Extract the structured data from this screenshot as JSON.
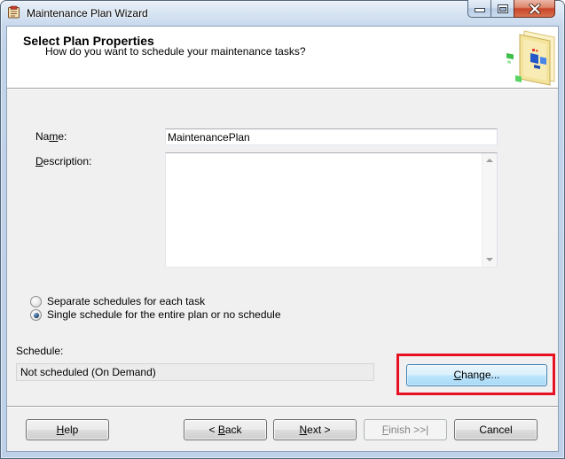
{
  "window": {
    "title": "Maintenance Plan Wizard",
    "icon": "maintenance-wizard-icon",
    "controls": [
      "minimize-icon",
      "maximize-icon",
      "close-icon"
    ]
  },
  "header": {
    "title": "Select Plan Properties",
    "subtitle": "How do you want to schedule your maintenance tasks?",
    "graphic": "wizard-graphic-icon"
  },
  "form": {
    "name": {
      "label": {
        "pre": "Na",
        "key": "m",
        "post": "e:"
      },
      "value": "MaintenancePlan"
    },
    "description": {
      "label": {
        "pre": "",
        "key": "D",
        "post": "escription:"
      },
      "value": ""
    },
    "schedule_mode": [
      {
        "label": "Separate schedules for each task",
        "checked": false
      },
      {
        "label": "Single schedule for the entire plan or no schedule",
        "checked": true
      }
    ],
    "schedule": {
      "label": "Schedule:",
      "value": "Not scheduled (On Demand)",
      "change_button": {
        "pre": "",
        "key": "C",
        "post": "hange..."
      }
    }
  },
  "footer": {
    "buttons": [
      {
        "pre": "",
        "key": "H",
        "post": "elp",
        "enabled": true
      },
      {
        "pre": "< ",
        "key": "B",
        "post": "ack",
        "enabled": true
      },
      {
        "pre": "",
        "key": "N",
        "post": "ext >",
        "enabled": true
      },
      {
        "pre": "",
        "key": "F",
        "post": "inish >>|",
        "enabled": false
      },
      {
        "pre": "Cancel",
        "key": "",
        "post": "",
        "enabled": true
      }
    ]
  },
  "annotation": {
    "color": "#e81123"
  }
}
